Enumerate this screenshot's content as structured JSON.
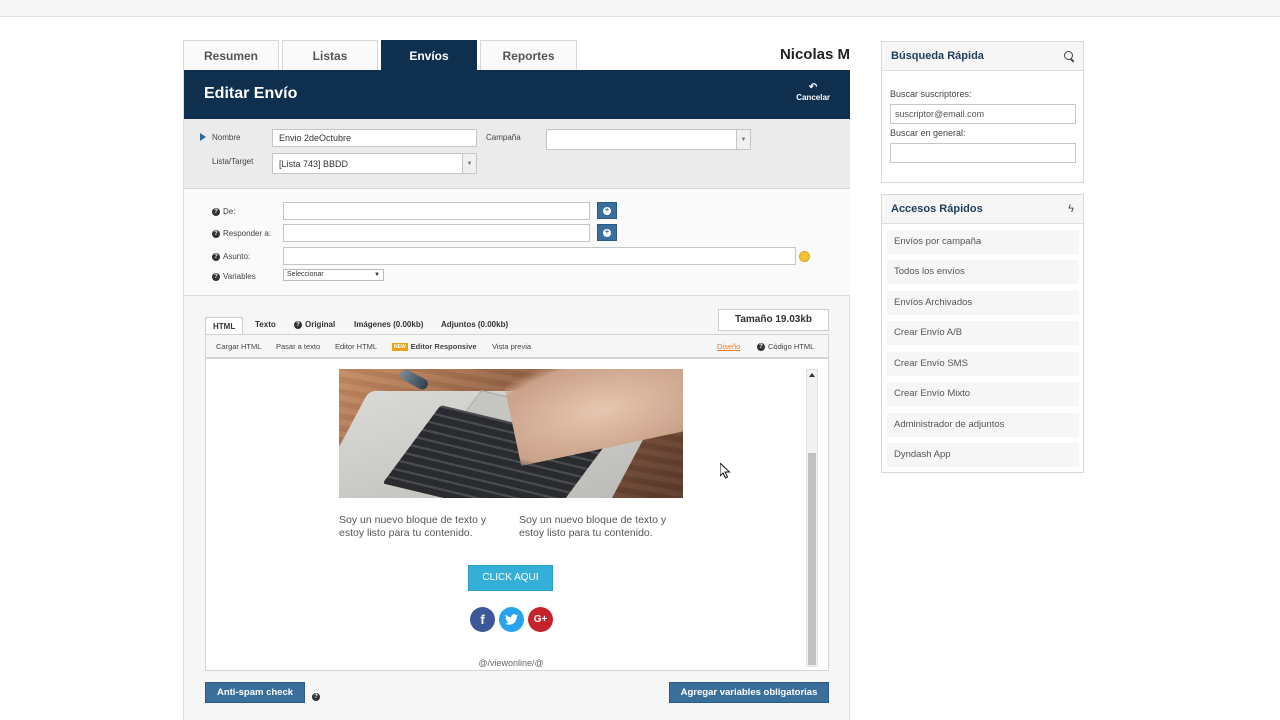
{
  "user": {
    "name": "Nicolas M"
  },
  "tabs": [
    {
      "label": "Resumen",
      "active": false
    },
    {
      "label": "Listas",
      "active": false
    },
    {
      "label": "Envíos",
      "active": true
    },
    {
      "label": "Reportes",
      "active": false
    }
  ],
  "editor": {
    "title": "Editar Envío",
    "cancel_label": "Cancelar",
    "cancel_icon": "undo-icon",
    "fields": {
      "nombre_label": "Nombre",
      "nombre_value": "Envio 2deOctubre",
      "campana_label": "Campaña",
      "campana_value": "",
      "lista_label": "Lista/Target",
      "lista_value": "[Lista 743] BBDD",
      "de_label": "De:",
      "responder_label": "Responder a:",
      "asunto_label": "Asunto:",
      "variables_label": "Variables",
      "variables_value": "Seleccionar"
    },
    "content_tabs": [
      "HTML",
      "Texto",
      "Original",
      "Imágenes (0.00kb)",
      "Adjuntos (0.00kb)"
    ],
    "size_label": "Tamaño 19.03kb",
    "toolbar": {
      "cargar_html": "Cargar HTML",
      "pasar_texto": "Pasar a texto",
      "editor_html": "Editor HTML",
      "new_badge": "NEW",
      "editor_responsive": "Editor Responsive",
      "vista_previa": "Vista previa",
      "diseno": "Diseño",
      "codigo_html": "Código HTML"
    },
    "preview": {
      "text_block_1": "Soy un nuevo bloque de texto y estoy listo para tu contenido.",
      "text_block_2": "Soy un nuevo bloque de texto y estoy listo para tu contenido.",
      "cta_label": "CLICK AQUI",
      "social": [
        {
          "name": "facebook-icon",
          "glyph": "f",
          "color": "#3b5998"
        },
        {
          "name": "twitter-icon",
          "glyph": "t",
          "color": "#2aa3ef"
        },
        {
          "name": "google-plus-icon",
          "glyph": "G+",
          "color": "#c4232b"
        }
      ],
      "footer": "@/viewonline/@"
    },
    "antispam_label": "Anti-spam check",
    "agregar_label": "Agregar variables obligatorias"
  },
  "busqueda": {
    "title": "Búsqueda Rápida",
    "suscriptores_label": "Buscar suscriptores:",
    "suscriptores_placeholder": "suscriptor@email.com",
    "general_label": "Buscar en general:",
    "general_placeholder": ""
  },
  "accesos": {
    "title": "Accesos Rápidos",
    "items": [
      "Envíos por campaña",
      "Todos los envíos",
      "Envíos Archivados",
      "Crear Envío A/B",
      "Crear Envío SMS",
      "Crear Envío Mixto",
      "Administrador de adjuntos",
      "Dyndash App"
    ]
  },
  "colors": {
    "header": "#0e2f4d",
    "button": "#3a6f9c",
    "cta": "#34b0d8",
    "link": "#e07b2a"
  }
}
